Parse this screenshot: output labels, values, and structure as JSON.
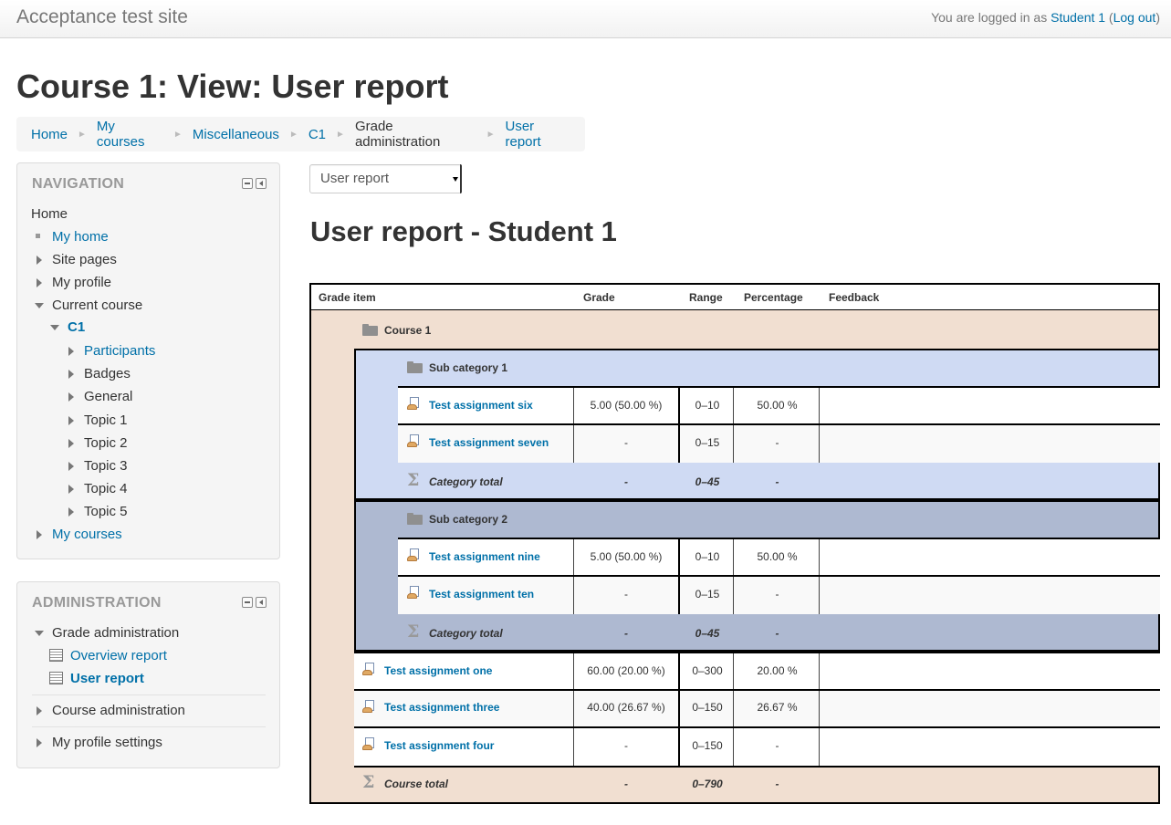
{
  "site": {
    "name": "Acceptance test site",
    "login_prefix": "You are logged in as ",
    "user_name": "Student 1",
    "logout_open": " (",
    "logout_label": "Log out",
    "logout_close": ")"
  },
  "page_title": "Course 1: View: User report",
  "breadcrumb": {
    "items": [
      "Home",
      "My courses",
      "Miscellaneous",
      "C1",
      "Grade administration",
      "User report"
    ],
    "separator": "►"
  },
  "navigation": {
    "title": "NAVIGATION",
    "home": "Home",
    "my_home": "My home",
    "site_pages": "Site pages",
    "my_profile": "My profile",
    "current_course": "Current course",
    "course_short": "C1",
    "participants": "Participants",
    "badges": "Badges",
    "general": "General",
    "topics": [
      "Topic 1",
      "Topic 2",
      "Topic 3",
      "Topic 4",
      "Topic 5"
    ],
    "my_courses": "My courses"
  },
  "administration": {
    "title": "ADMINISTRATION",
    "grade_admin": "Grade administration",
    "overview_report": "Overview report",
    "user_report": "User report",
    "course_admin": "Course administration",
    "profile_settings": "My profile settings"
  },
  "report_select": {
    "value": "User report"
  },
  "report_title": "User report - Student 1",
  "table": {
    "headers": {
      "item": "Grade item",
      "grade": "Grade",
      "range": "Range",
      "percentage": "Percentage",
      "feedback": "Feedback"
    },
    "course_name": "Course 1",
    "subcategories": [
      {
        "name": "Sub category 1",
        "items": [
          {
            "name": "Test assignment six",
            "grade": "5.00 (50.00 %)",
            "range": "0–10",
            "percentage": "50.00 %"
          },
          {
            "name": "Test assignment seven",
            "grade": "-",
            "range": "0–15",
            "percentage": "-"
          }
        ],
        "total": {
          "label": "Category total",
          "grade": "-",
          "range": "0–45",
          "percentage": "-"
        }
      },
      {
        "name": "Sub category 2",
        "items": [
          {
            "name": "Test assignment nine",
            "grade": "5.00 (50.00 %)",
            "range": "0–10",
            "percentage": "50.00 %"
          },
          {
            "name": "Test assignment ten",
            "grade": "-",
            "range": "0–15",
            "percentage": "-"
          }
        ],
        "total": {
          "label": "Category total",
          "grade": "-",
          "range": "0–45",
          "percentage": "-"
        }
      }
    ],
    "items": [
      {
        "name": "Test assignment one",
        "grade": "60.00 (20.00 %)",
        "range": "0–300",
        "percentage": "20.00 %"
      },
      {
        "name": "Test assignment three",
        "grade": "40.00 (26.67 %)",
        "range": "0–150",
        "percentage": "26.67 %"
      },
      {
        "name": "Test assignment four",
        "grade": "-",
        "range": "0–150",
        "percentage": "-"
      }
    ],
    "course_total": {
      "label": "Course total",
      "grade": "-",
      "range": "0–790",
      "percentage": "-"
    }
  },
  "colors": {
    "link": "#0070a8",
    "course_bg": "#f1dfd1",
    "subcat1_bg": "#cfdaf3",
    "subcat2_bg": "#aeb9d1"
  }
}
